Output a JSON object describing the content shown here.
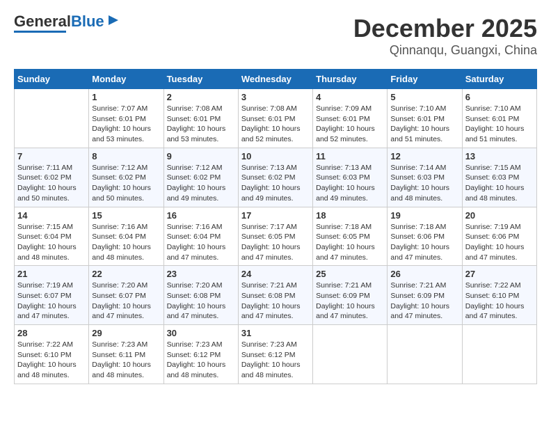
{
  "header": {
    "logo_general": "General",
    "logo_blue": "Blue",
    "month": "December 2025",
    "location": "Qinnanqu, Guangxi, China"
  },
  "days_of_week": [
    "Sunday",
    "Monday",
    "Tuesday",
    "Wednesday",
    "Thursday",
    "Friday",
    "Saturday"
  ],
  "weeks": [
    [
      {
        "day": "",
        "info": ""
      },
      {
        "day": "1",
        "info": "Sunrise: 7:07 AM\nSunset: 6:01 PM\nDaylight: 10 hours\nand 53 minutes."
      },
      {
        "day": "2",
        "info": "Sunrise: 7:08 AM\nSunset: 6:01 PM\nDaylight: 10 hours\nand 53 minutes."
      },
      {
        "day": "3",
        "info": "Sunrise: 7:08 AM\nSunset: 6:01 PM\nDaylight: 10 hours\nand 52 minutes."
      },
      {
        "day": "4",
        "info": "Sunrise: 7:09 AM\nSunset: 6:01 PM\nDaylight: 10 hours\nand 52 minutes."
      },
      {
        "day": "5",
        "info": "Sunrise: 7:10 AM\nSunset: 6:01 PM\nDaylight: 10 hours\nand 51 minutes."
      },
      {
        "day": "6",
        "info": "Sunrise: 7:10 AM\nSunset: 6:01 PM\nDaylight: 10 hours\nand 51 minutes."
      }
    ],
    [
      {
        "day": "7",
        "info": "Sunrise: 7:11 AM\nSunset: 6:02 PM\nDaylight: 10 hours\nand 50 minutes."
      },
      {
        "day": "8",
        "info": "Sunrise: 7:12 AM\nSunset: 6:02 PM\nDaylight: 10 hours\nand 50 minutes."
      },
      {
        "day": "9",
        "info": "Sunrise: 7:12 AM\nSunset: 6:02 PM\nDaylight: 10 hours\nand 49 minutes."
      },
      {
        "day": "10",
        "info": "Sunrise: 7:13 AM\nSunset: 6:02 PM\nDaylight: 10 hours\nand 49 minutes."
      },
      {
        "day": "11",
        "info": "Sunrise: 7:13 AM\nSunset: 6:03 PM\nDaylight: 10 hours\nand 49 minutes."
      },
      {
        "day": "12",
        "info": "Sunrise: 7:14 AM\nSunset: 6:03 PM\nDaylight: 10 hours\nand 48 minutes."
      },
      {
        "day": "13",
        "info": "Sunrise: 7:15 AM\nSunset: 6:03 PM\nDaylight: 10 hours\nand 48 minutes."
      }
    ],
    [
      {
        "day": "14",
        "info": "Sunrise: 7:15 AM\nSunset: 6:04 PM\nDaylight: 10 hours\nand 48 minutes."
      },
      {
        "day": "15",
        "info": "Sunrise: 7:16 AM\nSunset: 6:04 PM\nDaylight: 10 hours\nand 48 minutes."
      },
      {
        "day": "16",
        "info": "Sunrise: 7:16 AM\nSunset: 6:04 PM\nDaylight: 10 hours\nand 47 minutes."
      },
      {
        "day": "17",
        "info": "Sunrise: 7:17 AM\nSunset: 6:05 PM\nDaylight: 10 hours\nand 47 minutes."
      },
      {
        "day": "18",
        "info": "Sunrise: 7:18 AM\nSunset: 6:05 PM\nDaylight: 10 hours\nand 47 minutes."
      },
      {
        "day": "19",
        "info": "Sunrise: 7:18 AM\nSunset: 6:06 PM\nDaylight: 10 hours\nand 47 minutes."
      },
      {
        "day": "20",
        "info": "Sunrise: 7:19 AM\nSunset: 6:06 PM\nDaylight: 10 hours\nand 47 minutes."
      }
    ],
    [
      {
        "day": "21",
        "info": "Sunrise: 7:19 AM\nSunset: 6:07 PM\nDaylight: 10 hours\nand 47 minutes."
      },
      {
        "day": "22",
        "info": "Sunrise: 7:20 AM\nSunset: 6:07 PM\nDaylight: 10 hours\nand 47 minutes."
      },
      {
        "day": "23",
        "info": "Sunrise: 7:20 AM\nSunset: 6:08 PM\nDaylight: 10 hours\nand 47 minutes."
      },
      {
        "day": "24",
        "info": "Sunrise: 7:21 AM\nSunset: 6:08 PM\nDaylight: 10 hours\nand 47 minutes."
      },
      {
        "day": "25",
        "info": "Sunrise: 7:21 AM\nSunset: 6:09 PM\nDaylight: 10 hours\nand 47 minutes."
      },
      {
        "day": "26",
        "info": "Sunrise: 7:21 AM\nSunset: 6:09 PM\nDaylight: 10 hours\nand 47 minutes."
      },
      {
        "day": "27",
        "info": "Sunrise: 7:22 AM\nSunset: 6:10 PM\nDaylight: 10 hours\nand 47 minutes."
      }
    ],
    [
      {
        "day": "28",
        "info": "Sunrise: 7:22 AM\nSunset: 6:10 PM\nDaylight: 10 hours\nand 48 minutes."
      },
      {
        "day": "29",
        "info": "Sunrise: 7:23 AM\nSunset: 6:11 PM\nDaylight: 10 hours\nand 48 minutes."
      },
      {
        "day": "30",
        "info": "Sunrise: 7:23 AM\nSunset: 6:12 PM\nDaylight: 10 hours\nand 48 minutes."
      },
      {
        "day": "31",
        "info": "Sunrise: 7:23 AM\nSunset: 6:12 PM\nDaylight: 10 hours\nand 48 minutes."
      },
      {
        "day": "",
        "info": ""
      },
      {
        "day": "",
        "info": ""
      },
      {
        "day": "",
        "info": ""
      }
    ]
  ]
}
